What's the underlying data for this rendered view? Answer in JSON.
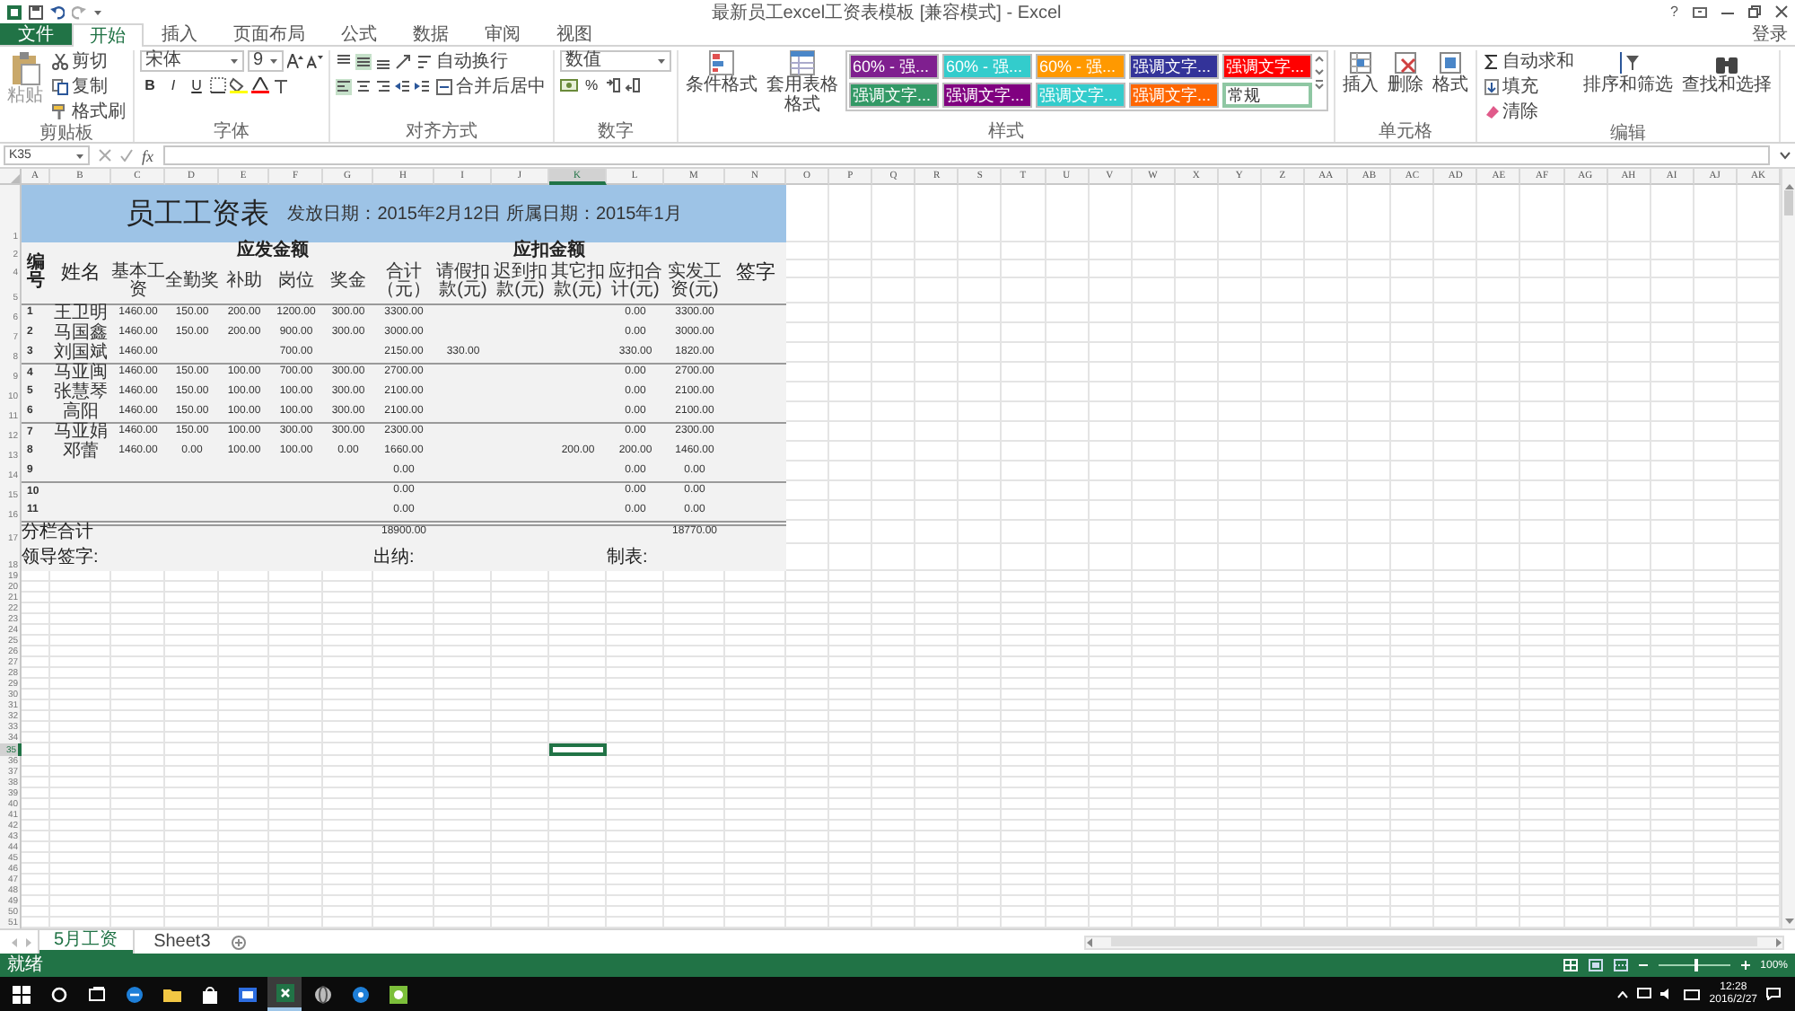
{
  "window": {
    "title": "最新员工excel工资表模板 [兼容模式] - Excel",
    "help": "?"
  },
  "account": "登录",
  "ribbon_tabs": [
    {
      "label": "文件",
      "kind": "file",
      "selected": false
    },
    {
      "label": "开始",
      "kind": "tab",
      "selected": true
    },
    {
      "label": "插入",
      "kind": "tab",
      "selected": false
    },
    {
      "label": "页面布局",
      "kind": "tab",
      "selected": false
    },
    {
      "label": "公式",
      "kind": "tab",
      "selected": false
    },
    {
      "label": "数据",
      "kind": "tab",
      "selected": false
    },
    {
      "label": "审阅",
      "kind": "tab",
      "selected": false
    },
    {
      "label": "视图",
      "kind": "tab",
      "selected": false
    }
  ],
  "clipboard": {
    "paste": "粘贴",
    "cut": "剪切",
    "copy": "复制",
    "format_painter": "格式刷",
    "label": "剪贴板"
  },
  "font": {
    "name": "宋体",
    "size": "9",
    "styles": [
      "B",
      "I",
      "U"
    ],
    "label": "字体"
  },
  "alignment": {
    "wrap": "自动换行",
    "merge": "合并后居中",
    "label": "对齐方式"
  },
  "number": {
    "format": "数值",
    "percent": "%",
    "label": "数字"
  },
  "styles": {
    "conditional": "条件格式",
    "table_format": "套用表格格式",
    "label": "样式",
    "gallery": [
      {
        "label": "60% - 强...",
        "color": "#7f1f8f",
        "selected": false
      },
      {
        "label": "60% - 强...",
        "color": "#33cccc",
        "selected": false
      },
      {
        "label": "60% - 强...",
        "color": "#ff9900",
        "selected": false
      },
      {
        "label": "强调文字...",
        "color": "#333399",
        "selected": false
      },
      {
        "label": "强调文字...",
        "color": "#ff0000",
        "selected": false
      },
      {
        "label": "强调文字...",
        "color": "#339966",
        "selected": false
      },
      {
        "label": "强调文字...",
        "color": "#800080",
        "selected": false
      },
      {
        "label": "强调文字...",
        "color": "#33cccc",
        "selected": false
      },
      {
        "label": "强调文字...",
        "color": "#ff6600",
        "selected": false
      },
      {
        "label": "常规",
        "color": "#ffffff",
        "selected": true
      }
    ]
  },
  "cells": {
    "buttons": [
      "插入",
      "删除",
      "格式"
    ],
    "label": "单元格"
  },
  "editing": {
    "autosum": "自动求和",
    "fill": "填充",
    "clear": "清除",
    "sort": "排序和筛选",
    "find": "查找和选择",
    "label": "编辑"
  },
  "formula_bar": {
    "name_box": "K35",
    "fx": "fx"
  },
  "sheet": {
    "columns": [
      {
        "label": "A",
        "selected": false
      },
      {
        "label": "B",
        "selected": false
      },
      {
        "label": "C",
        "selected": false
      },
      {
        "label": "D",
        "selected": false
      },
      {
        "label": "E",
        "selected": false
      },
      {
        "label": "F",
        "selected": false
      },
      {
        "label": "G",
        "selected": false
      },
      {
        "label": "H",
        "selected": false
      },
      {
        "label": "I",
        "selected": false
      },
      {
        "label": "J",
        "selected": false
      },
      {
        "label": "K",
        "selected": true
      },
      {
        "label": "L",
        "selected": false
      },
      {
        "label": "M",
        "selected": false
      },
      {
        "label": "N",
        "selected": false
      },
      {
        "label": "O",
        "selected": false
      },
      {
        "label": "P",
        "selected": false
      },
      {
        "label": "Q",
        "selected": false
      },
      {
        "label": "R",
        "selected": false
      },
      {
        "label": "S",
        "selected": false
      },
      {
        "label": "T",
        "selected": false
      },
      {
        "label": "U",
        "selected": false
      },
      {
        "label": "V",
        "selected": false
      },
      {
        "label": "W",
        "selected": false
      },
      {
        "label": "X",
        "selected": false
      },
      {
        "label": "Y",
        "selected": false
      },
      {
        "label": "Z",
        "selected": false
      },
      {
        "label": "AA",
        "selected": false
      },
      {
        "label": "AB",
        "selected": false
      },
      {
        "label": "AC",
        "selected": false
      },
      {
        "label": "AD",
        "selected": false
      },
      {
        "label": "AE",
        "selected": false
      },
      {
        "label": "AF",
        "selected": false
      },
      {
        "label": "AG",
        "selected": false
      },
      {
        "label": "AH",
        "selected": false
      },
      {
        "label": "AI",
        "selected": false
      },
      {
        "label": "AJ",
        "selected": false
      },
      {
        "label": "AK",
        "selected": false
      }
    ],
    "rows": [
      {
        "label": "1",
        "selected": false
      },
      {
        "label": "2",
        "selected": false
      },
      {
        "label": "4",
        "selected": false
      },
      {
        "label": "5",
        "selected": false
      },
      {
        "label": "6",
        "selected": false
      },
      {
        "label": "7",
        "selected": false
      },
      {
        "label": "8",
        "selected": false
      },
      {
        "label": "9",
        "selected": false
      },
      {
        "label": "10",
        "selected": false
      },
      {
        "label": "11",
        "selected": false
      },
      {
        "label": "12",
        "selected": false
      },
      {
        "label": "13",
        "selected": false
      },
      {
        "label": "14",
        "selected": false
      },
      {
        "label": "15",
        "selected": false
      },
      {
        "label": "16",
        "selected": false
      },
      {
        "label": "17",
        "selected": false
      },
      {
        "label": "18",
        "selected": false
      },
      {
        "label": "19",
        "selected": false
      },
      {
        "label": "20",
        "selected": false
      },
      {
        "label": "21",
        "selected": false
      },
      {
        "label": "22",
        "selected": false
      },
      {
        "label": "23",
        "selected": false
      },
      {
        "label": "24",
        "selected": false
      },
      {
        "label": "25",
        "selected": false
      },
      {
        "label": "26",
        "selected": false
      },
      {
        "label": "27",
        "selected": false
      },
      {
        "label": "28",
        "selected": false
      },
      {
        "label": "29",
        "selected": false
      },
      {
        "label": "30",
        "selected": false
      },
      {
        "label": "31",
        "selected": false
      },
      {
        "label": "32",
        "selected": false
      },
      {
        "label": "33",
        "selected": false
      },
      {
        "label": "34",
        "selected": false
      },
      {
        "label": "35",
        "selected": true
      },
      {
        "label": "36",
        "selected": false
      },
      {
        "label": "37",
        "selected": false
      },
      {
        "label": "38",
        "selected": false
      },
      {
        "label": "39",
        "selected": false
      },
      {
        "label": "40",
        "selected": false
      },
      {
        "label": "41",
        "selected": false
      },
      {
        "label": "42",
        "selected": false
      },
      {
        "label": "43",
        "selected": false
      },
      {
        "label": "44",
        "selected": false
      },
      {
        "label": "45",
        "selected": false
      },
      {
        "label": "46",
        "selected": false
      },
      {
        "label": "47",
        "selected": false
      },
      {
        "label": "48",
        "selected": false
      },
      {
        "label": "49",
        "selected": false
      },
      {
        "label": "50",
        "selected": false
      },
      {
        "label": "51",
        "selected": false
      }
    ]
  },
  "payroll": {
    "title": "员工工资表",
    "issue_info": "发放日期：2015年2月12日 所属日期：2015年1月",
    "headers": {
      "id": "编号",
      "name": "姓名",
      "earn_group": "应发金额",
      "earn_columns": [
        "基本工资",
        "全勤奖",
        "补助",
        "岗位",
        "奖金",
        "合计（元）"
      ],
      "deduct_group": "应扣金额",
      "deduct_columns": [
        "请假扣款(元)",
        "迟到扣款(元)",
        "其它扣款(元)",
        "应扣合计(元)"
      ],
      "net": "实发工资(元)",
      "sign": "签字"
    },
    "rows": [
      {
        "id": "1",
        "name": "王卫明",
        "divider_above": false,
        "values": {
          "C": "1460.00",
          "D": "150.00",
          "E": "200.00",
          "F": "1200.00",
          "G": "300.00",
          "H": "3300.00",
          "L": "0.00",
          "M": "3300.00"
        }
      },
      {
        "id": "2",
        "name": "马国鑫",
        "divider_above": false,
        "values": {
          "C": "1460.00",
          "D": "150.00",
          "E": "200.00",
          "F": "900.00",
          "G": "300.00",
          "H": "3000.00",
          "L": "0.00",
          "M": "3000.00"
        }
      },
      {
        "id": "3",
        "name": "刘国斌",
        "divider_above": false,
        "values": {
          "C": "1460.00",
          "F": "700.00",
          "H": "2150.00",
          "I": "330.00",
          "L": "330.00",
          "M": "1820.00"
        }
      },
      {
        "id": "4",
        "name": "马亚闽",
        "divider_above": true,
        "values": {
          "C": "1460.00",
          "D": "150.00",
          "E": "100.00",
          "F": "700.00",
          "G": "300.00",
          "H": "2700.00",
          "L": "0.00",
          "M": "2700.00"
        }
      },
      {
        "id": "5",
        "name": "张慧琴",
        "divider_above": false,
        "values": {
          "C": "1460.00",
          "D": "150.00",
          "E": "100.00",
          "F": "100.00",
          "G": "300.00",
          "H": "2100.00",
          "L": "0.00",
          "M": "2100.00"
        }
      },
      {
        "id": "6",
        "name": "高阳",
        "divider_above": false,
        "values": {
          "C": "1460.00",
          "D": "150.00",
          "E": "100.00",
          "F": "100.00",
          "G": "300.00",
          "H": "2100.00",
          "L": "0.00",
          "M": "2100.00"
        }
      },
      {
        "id": "7",
        "name": "马亚娟",
        "divider_above": true,
        "values": {
          "C": "1460.00",
          "D": "150.00",
          "E": "100.00",
          "F": "300.00",
          "G": "300.00",
          "H": "2300.00",
          "L": "0.00",
          "M": "2300.00"
        }
      },
      {
        "id": "8",
        "name": "邓蕾",
        "divider_above": false,
        "values": {
          "C": "1460.00",
          "D": "0.00",
          "E": "100.00",
          "F": "100.00",
          "G": "0.00",
          "H": "1660.00",
          "K": "200.00",
          "L": "200.00",
          "M": "1460.00"
        }
      },
      {
        "id": "9",
        "divider_above": false,
        "values": {
          "H": "0.00",
          "L": "0.00",
          "M": "0.00"
        }
      },
      {
        "id": "10",
        "divider_above": true,
        "values": {
          "H": "0.00",
          "L": "0.00",
          "M": "0.00"
        }
      },
      {
        "id": "11",
        "divider_above": false,
        "values": {
          "H": "0.00",
          "L": "0.00",
          "M": "0.00"
        }
      }
    ],
    "subtotal": {
      "label": "分栏合计",
      "total": "18900.00",
      "net": "18770.00"
    },
    "signatures": [
      "领导签字:",
      "出纳:",
      "制表:"
    ]
  },
  "sheet_tabs": [
    {
      "label": "5月工资",
      "selected": true
    },
    {
      "label": "Sheet3",
      "selected": false
    }
  ],
  "status_bar": {
    "text": "就绪",
    "zoom": "100%",
    "zoom_slider": {
      "level": 0.5
    }
  },
  "taskbar": {
    "apps": [
      {
        "kind": "search",
        "selected": false
      },
      {
        "kind": "taskview",
        "selected": false
      },
      {
        "kind": "browser",
        "selected": false
      },
      {
        "kind": "folder",
        "selected": false
      },
      {
        "kind": "store",
        "selected": false
      },
      {
        "kind": "app",
        "selected": false
      },
      {
        "kind": "spreadsheet",
        "selected": true
      },
      {
        "kind": "globe",
        "selected": false
      },
      {
        "kind": "help",
        "selected": false
      },
      {
        "kind": "game",
        "selected": false
      }
    ],
    "time": "12:28",
    "date": "2016/2/27"
  }
}
